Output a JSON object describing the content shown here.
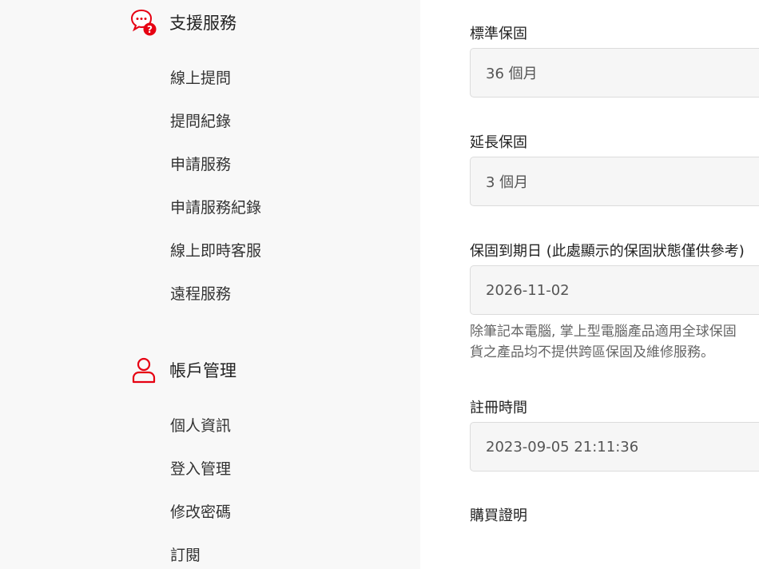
{
  "sidebar": {
    "support": {
      "title": "支援服務",
      "icon": "chat-question-icon",
      "items": [
        "線上提問",
        "提問紀錄",
        "申請服務",
        "申請服務紀錄",
        "線上即時客服",
        "遠程服務"
      ]
    },
    "account": {
      "title": "帳戶管理",
      "icon": "user-icon",
      "items": [
        "個人資訊",
        "登入管理",
        "修改密碼",
        "訂閱"
      ]
    }
  },
  "warranty": {
    "standard_label": "標準保固",
    "standard_value": "36 個月",
    "extended_label": "延長保固",
    "extended_value": "3 個月",
    "expiry_label": "保固到期日 (此處顯示的保固狀態僅供參考)",
    "expiry_value": "2026-11-02",
    "note_line1": "除筆記本電腦, 掌上型電腦產品適用全球保固",
    "note_line2": "貨之產品均不提供跨區保固及維修服務。",
    "registered_label": "註冊時間",
    "registered_value": "2023-09-05 21:11:36",
    "proof_label": "購買證明"
  },
  "colors": {
    "accent": "#e60012",
    "sidebar_bg": "#f8f8f8"
  }
}
